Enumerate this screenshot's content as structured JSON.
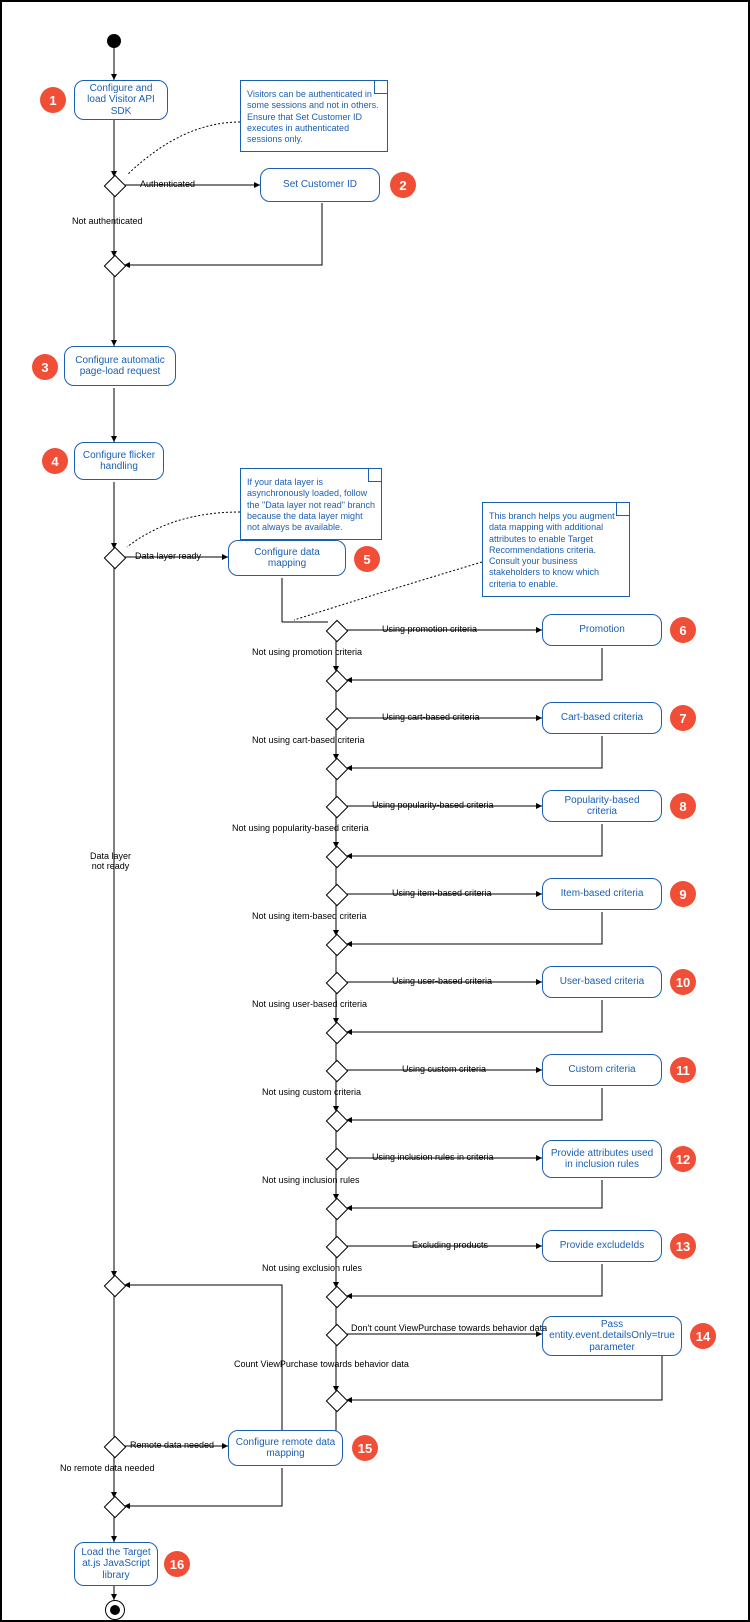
{
  "steps": {
    "s1": "Configure and load Visitor API SDK",
    "s2": "Set Customer ID",
    "s3": "Configure automatic page-load request",
    "s4": "Configure flicker handling",
    "s5": "Configure data mapping",
    "s6": "Promotion",
    "s7": "Cart-based criteria",
    "s8": "Popularity-based criteria",
    "s9": "Item-based criteria",
    "s10": "User-based criteria",
    "s11": "Custom criteria",
    "s12": "Provide attributes used in inclusion rules",
    "s13": "Provide excludeIds",
    "s14": "Pass entity.event.detailsOnly=true parameter",
    "s15": "Configure remote data mapping",
    "s16": "Load the Target at.js JavaScript library"
  },
  "notes": {
    "n1": "Visitors can be authenticated in some sessions and not in others. Ensure that Set Customer ID executes in authenticated sessions only.",
    "n2": "If your data layer is asynchronously loaded, follow the \"Data layer not read\" branch because the data layer might not always be available.",
    "n3": "This branch helps you augment data mapping with additional attributes to enable Target Recommendations criteria. Consult your business stakeholders to know which criteria to enable."
  },
  "labels": {
    "auth": "Authenticated",
    "notAuth": "Not authenticated",
    "dlReady": "Data layer ready",
    "dlNotReady": "Data layer\nnot ready",
    "upc": "Using promotion criteria",
    "nupc": "Not using promotion criteria",
    "ucb": "Using cart-based criteria",
    "nucb": "Not using cart-based criteria",
    "upb": "Using popularity-based criteria",
    "nupb": "Not using popularity-based criteria",
    "uib": "Using item-based criteria",
    "nuib": "Not using item-based criteria",
    "uub": "Using user-based criteria",
    "nuub": "Not using user-based criteria",
    "ucc": "Using custom criteria",
    "nucc": "Not using custom criteria",
    "uir": "Using inclusion rules in criteria",
    "nuir": "Not using inclusion rules",
    "exc": "Excluding products",
    "nexc": "Not using exclusion rules",
    "dcv": "Don't count ViewPurchase towards behavior data",
    "cvp": "Count ViewPurchase towards behavior data",
    "rdn": "Remote data needed",
    "nrdn": "No remote data needed"
  },
  "chart_data": {
    "type": "activity_diagram",
    "title": "",
    "nodes": [
      {
        "id": 1,
        "label": "Configure and load Visitor API SDK"
      },
      {
        "id": 2,
        "label": "Set Customer ID"
      },
      {
        "id": 3,
        "label": "Configure automatic page-load request"
      },
      {
        "id": 4,
        "label": "Configure flicker handling"
      },
      {
        "id": 5,
        "label": "Configure data mapping"
      },
      {
        "id": 6,
        "label": "Promotion"
      },
      {
        "id": 7,
        "label": "Cart-based criteria"
      },
      {
        "id": 8,
        "label": "Popularity-based criteria"
      },
      {
        "id": 9,
        "label": "Item-based criteria"
      },
      {
        "id": 10,
        "label": "User-based criteria"
      },
      {
        "id": 11,
        "label": "Custom criteria"
      },
      {
        "id": 12,
        "label": "Provide attributes used in inclusion rules"
      },
      {
        "id": 13,
        "label": "Provide excludeIds"
      },
      {
        "id": 14,
        "label": "Pass entity.event.detailsOnly=true parameter"
      },
      {
        "id": 15,
        "label": "Configure remote data mapping"
      },
      {
        "id": 16,
        "label": "Load the Target at.js JavaScript library"
      }
    ],
    "notes": [
      "Visitors can be authenticated in some sessions and not in others. Ensure that Set Customer ID executes in authenticated sessions only.",
      "If your data layer is asynchronously loaded, follow the \"Data layer not read\" branch because the data layer might not always be available.",
      "This branch helps you augment data mapping with additional attributes to enable Target Recommendations criteria. Consult your business stakeholders to know which criteria to enable."
    ],
    "decisions": [
      {
        "condition": "Authenticated / Not authenticated",
        "yes": 2
      },
      {
        "condition": "Data layer ready / Data layer not ready",
        "yes": 5
      },
      {
        "condition": "Using promotion criteria / Not using promotion criteria",
        "yes": 6
      },
      {
        "condition": "Using cart-based criteria / Not using cart-based criteria",
        "yes": 7
      },
      {
        "condition": "Using popularity-based criteria / Not using popularity-based criteria",
        "yes": 8
      },
      {
        "condition": "Using item-based criteria / Not using item-based criteria",
        "yes": 9
      },
      {
        "condition": "Using user-based criteria / Not using user-based criteria",
        "yes": 10
      },
      {
        "condition": "Using custom criteria / Not using custom criteria",
        "yes": 11
      },
      {
        "condition": "Using inclusion rules in criteria / Not using inclusion rules",
        "yes": 12
      },
      {
        "condition": "Excluding products / Not using exclusion rules",
        "yes": 13
      },
      {
        "condition": "Don't count ViewPurchase towards behavior data / Count ViewPurchase towards behavior data",
        "yes": 14
      },
      {
        "condition": "Remote data needed / No remote data needed",
        "yes": 15
      }
    ]
  }
}
